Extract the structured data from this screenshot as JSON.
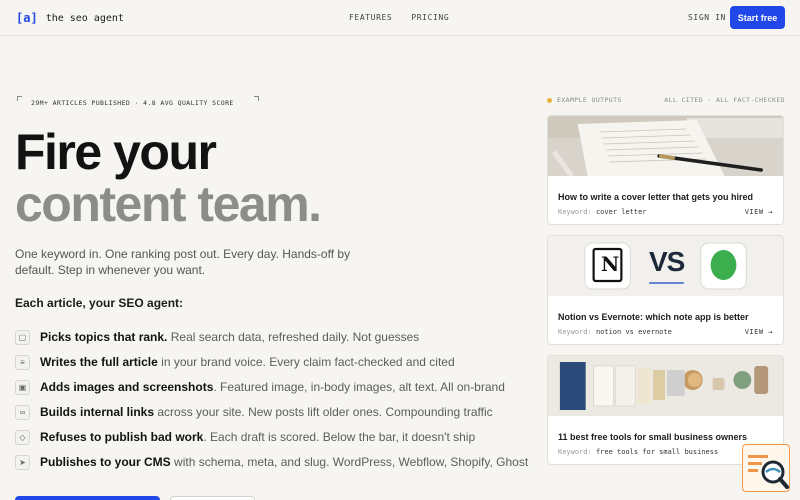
{
  "header": {
    "logo_mark": "[a]",
    "logo_text": "the seo agent",
    "nav": [
      "FEATURES",
      "PRICING"
    ],
    "signin": "SIGN IN",
    "cta": "Start free"
  },
  "hero": {
    "stats": "29M+ ARTICLES PUBLISHED · 4.8 AVG QUALITY SCORE",
    "headline_line1": "Fire your",
    "headline_line2": "content team.",
    "lead": "One keyword in. One ranking post out. Every day. Hands-off by default. Step in whenever you want.",
    "subheading": "Each article, your SEO agent:",
    "features": [
      {
        "strong": "Picks topics that rank.",
        "rest": " Real search data, refreshed daily. Not guesses",
        "icon": "document-icon"
      },
      {
        "strong": "Writes the full article",
        "rest": " in your brand voice. Every claim fact-checked and cited",
        "icon": "text-icon"
      },
      {
        "strong": "Adds images and screenshots",
        "rest": ". Featured image, in-body images, alt text. All on-brand",
        "icon": "images-icon"
      },
      {
        "strong": "Builds internal links",
        "rest": " across your site. New posts lift older ones. Compounding traffic",
        "icon": "link-icon"
      },
      {
        "strong": "Refuses to publish bad work",
        "rest": ". Each draft is scored. Below the bar, it doesn't ship",
        "icon": "shield-icon"
      },
      {
        "strong": "Publishes to your CMS",
        "rest": " with schema, meta, and slug. WordPress, Webflow, Shopify, Ghost",
        "icon": "send-icon"
      }
    ]
  },
  "examples": {
    "label": "EXAMPLE OUTPUTS",
    "badge": "ALL CITED · ALL FACT-CHECKED",
    "keyword_label": "Keyword:",
    "view_label": "VIEW →",
    "cards": [
      {
        "title": "How to write a cover letter that gets you hired",
        "keyword": "cover letter"
      },
      {
        "title": "Notion vs Evernote: which note app is better",
        "keyword": "notion vs evernote",
        "vs_text": "VS"
      },
      {
        "title": "11 best free tools for small business owners",
        "keyword": "free tools for small business"
      }
    ]
  }
}
